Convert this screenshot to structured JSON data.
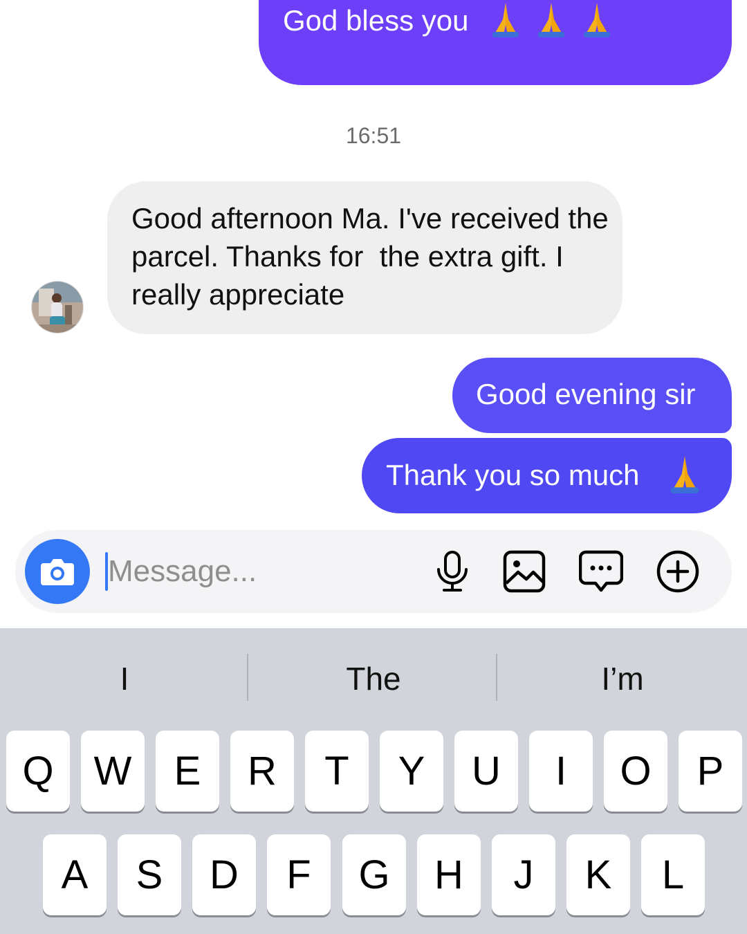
{
  "chat": {
    "messages": [
      {
        "id": "m1",
        "direction": "outgoing",
        "text": "God bless you",
        "emoji": [
          "🙏",
          "🙏",
          "🙏"
        ]
      },
      {
        "id": "m2",
        "direction": "incoming",
        "text": "Good afternoon Ma. I've received the parcel. Thanks for  the extra gift. I really appreciate"
      },
      {
        "id": "m3",
        "direction": "outgoing",
        "text": "Good evening sir"
      },
      {
        "id": "m4",
        "direction": "outgoing",
        "text": "Thank you so much",
        "emoji": [
          "🙏"
        ]
      }
    ],
    "timestamp": "16:51"
  },
  "composer": {
    "placeholder": "Message...",
    "icons": [
      "camera-icon",
      "microphone-icon",
      "image-icon",
      "sticker-chat-icon",
      "plus-icon"
    ]
  },
  "keyboard": {
    "suggestions": [
      "I",
      "The",
      "I’m"
    ],
    "row1": [
      "Q",
      "W",
      "E",
      "R",
      "T",
      "Y",
      "U",
      "I",
      "O",
      "P"
    ],
    "row2": [
      "A",
      "S",
      "D",
      "F",
      "G",
      "H",
      "J",
      "K",
      "L"
    ]
  },
  "colors": {
    "outgoing_bubble": "#6d3ff9",
    "outgoing_bubble_2": "#5048f2",
    "incoming_bubble": "#efefef",
    "accent_blue": "#3478f6",
    "keyboard_bg": "#d1d4da"
  }
}
